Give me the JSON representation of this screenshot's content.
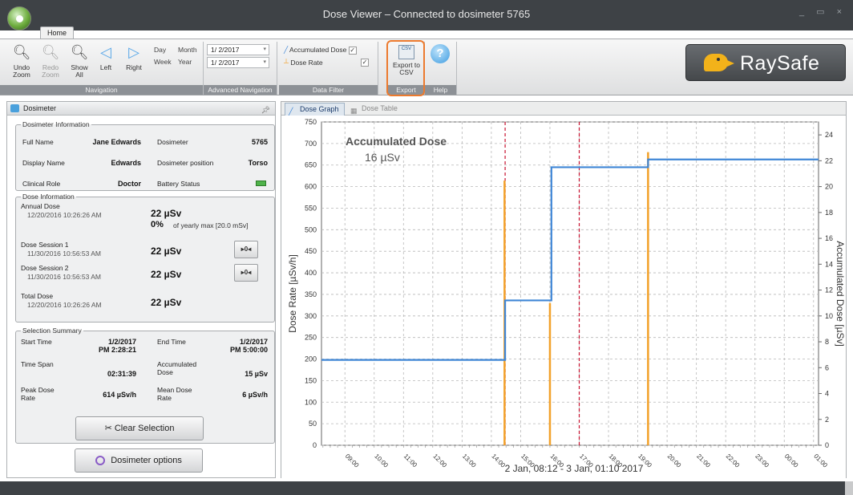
{
  "window": {
    "title": "Dose Viewer – Connected to dosimeter 5765",
    "controls": "_ ▭ ×"
  },
  "ribbon": {
    "tab": "Home",
    "navigation": {
      "label": "Navigation",
      "undo_zoom": "Undo Zoom",
      "redo_zoom": "Redo Zoom",
      "show_all": "Show All",
      "left": "Left",
      "right": "Right"
    },
    "advanced_navigation": {
      "label": "Advanced Navigation",
      "day": "Day",
      "month": "Month",
      "week": "Week",
      "year": "Year",
      "start_date": "1/ 2/2017",
      "end_date": "1/ 2/2017"
    },
    "data_filter": {
      "label": "Data Filter",
      "accumulated_dose": "Accumulated Dose",
      "dose_rate": "Dose Rate",
      "accumulated_checked": "✓",
      "rate_checked": "✓"
    },
    "export": {
      "label": "Export",
      "export_csv": "Export to CSV",
      "icon_text": "CSV"
    },
    "help": {
      "label": "Help",
      "icon_text": "?"
    },
    "logo": "RaySafe"
  },
  "left_panel": {
    "title": "Dosimeter",
    "dosimeter_info": {
      "legend": "Dosimeter Information",
      "full_name_label": "Full Name",
      "full_name": "Jane Edwards",
      "dosimeter_label": "Dosimeter",
      "dosimeter": "5765",
      "display_name_label": "Display Name",
      "display_name": "Edwards",
      "position_label": "Dosimeter position",
      "position": "Torso",
      "role_label": "Clinical Role",
      "role": "Doctor",
      "battery_label": "Battery Status"
    },
    "dose_info": {
      "legend": "Dose Information",
      "annual_label": "Annual Dose",
      "annual_ts": "12/20/2016 10:26:26 AM",
      "annual_value": "22 µSv",
      "yearly_pct": "0%",
      "yearly_text": "of yearly max [20.0 mSv]",
      "session1_label": "Dose Session 1",
      "session1_ts": "11/30/2016 10:56:53 AM",
      "session1_value": "22 µSv",
      "session2_label": "Dose Session 2",
      "session2_ts": "11/30/2016 10:56:53 AM",
      "session2_value": "22 µSv",
      "total_label": "Total Dose",
      "total_ts": "12/20/2016 10:26:26 AM",
      "total_value": "22 µSv",
      "reset_label": "▸0◂"
    },
    "selection": {
      "legend": "Selection Summary",
      "start_label": "Start Time",
      "start_date": "1/2/2017",
      "start_time": "PM 2:28:21",
      "end_label": "End Time",
      "end_date": "1/2/2017",
      "end_time": "PM 5:00:00",
      "span_label": "Time Span",
      "span": "02:31:39",
      "acc_label_1": "Accumulated",
      "acc_label_2": "Dose",
      "acc": "15 µSv",
      "peak_label_1": "Peak Dose",
      "peak_label_2": "Rate",
      "peak": "614 µSv/h",
      "mean_label_1": "Mean Dose",
      "mean_label_2": "Rate",
      "mean": "6 µSv/h",
      "clear_button": "Clear Selection"
    },
    "options_button": "Dosimeter options"
  },
  "right_panel": {
    "tabs": [
      "Dose Graph",
      "Dose Table"
    ]
  },
  "chart_data": {
    "type": "line",
    "annotation_title": "Accumulated Dose",
    "annotation_value": "16 µSv",
    "xlabel": "2 Jan, 08:12 - 3 Jan, 01:10 2017",
    "ylabel": "Dose Rate [µSv/h]",
    "y2label": "Accumulated Dose [µSv]",
    "ylim": [
      0,
      750
    ],
    "y2lim": [
      0,
      25
    ],
    "y_ticks": [
      0,
      50,
      100,
      150,
      200,
      250,
      300,
      350,
      400,
      450,
      500,
      550,
      600,
      650,
      700,
      750
    ],
    "y2_ticks": [
      0,
      2,
      4,
      6,
      8,
      10,
      12,
      14,
      16,
      18,
      20,
      22,
      24
    ],
    "x_range_hours": [
      8.2,
      25.17
    ],
    "x_ticks": [
      "09:00",
      "10:00",
      "11:00",
      "12:00",
      "13:00",
      "14:00",
      "15:00",
      "16:00",
      "17:00",
      "18:00",
      "19:00",
      "20:00",
      "21:00",
      "22:00",
      "23:00",
      "00:00",
      "01:00"
    ],
    "x_tick_hours": [
      9,
      10,
      11,
      12,
      13,
      14,
      15,
      16,
      17,
      18,
      19,
      20,
      21,
      22,
      23,
      24,
      25
    ],
    "accumulated_dose": {
      "name": "Accumulated Dose",
      "color": "#3f86d6",
      "steps_hour": [
        8.2,
        14.47,
        16.05,
        19.35,
        25.17
      ],
      "steps_value": [
        6.6,
        11.2,
        21.5,
        22.1,
        22.1
      ]
    },
    "dose_rate": {
      "name": "Dose Rate",
      "color": "#f2a12a",
      "spikes_hour": [
        14.45,
        16.0,
        19.35
      ],
      "spikes_value": [
        614,
        330,
        680
      ]
    },
    "selection_hours": [
      14.47,
      17.0
    ],
    "selection_color": "#c8102e",
    "grid": true
  }
}
